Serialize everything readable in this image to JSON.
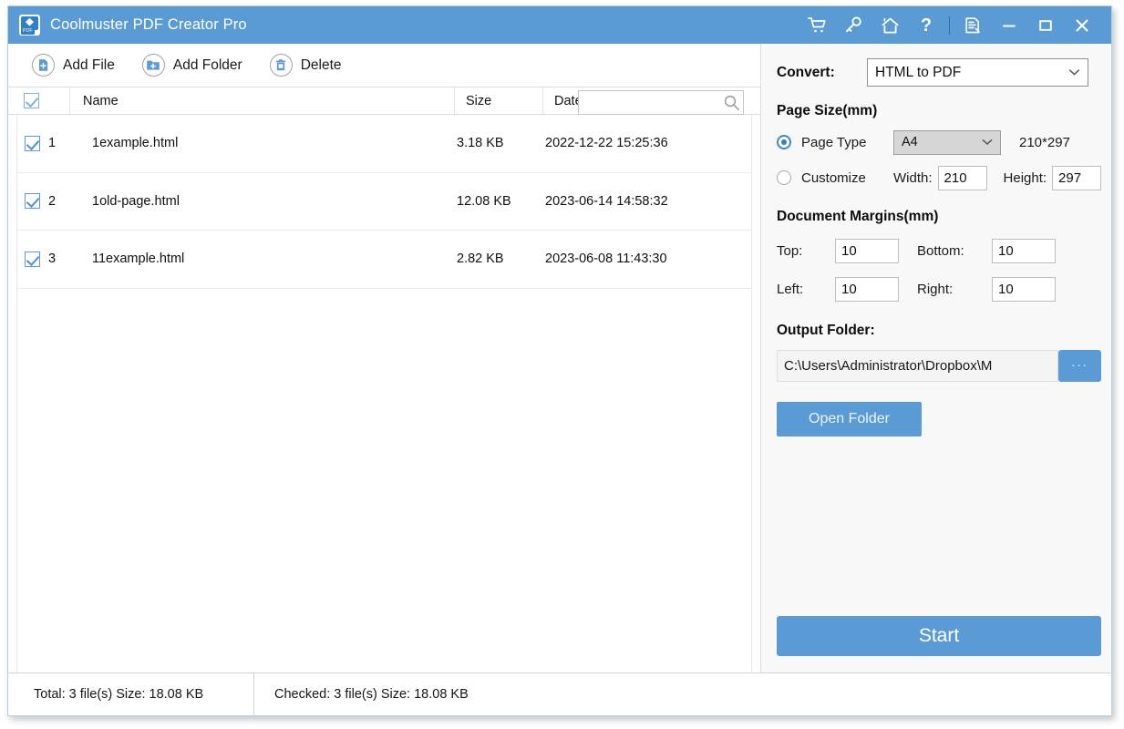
{
  "window": {
    "title": "Coolmuster PDF Creator Pro",
    "accent_color": "#5b9bd5",
    "logo_tag": "PDF"
  },
  "title_actions": [
    {
      "name": "cart-icon",
      "tooltip": "Buy"
    },
    {
      "name": "key-icon",
      "tooltip": "Register"
    },
    {
      "name": "home-icon",
      "tooltip": "Home"
    },
    {
      "name": "help-icon",
      "tooltip": "Help"
    },
    {
      "name": "register-icon",
      "tooltip": "Register"
    },
    {
      "name": "minimize-icon",
      "tooltip": "Minimize"
    },
    {
      "name": "maximize-icon",
      "tooltip": "Maximize"
    },
    {
      "name": "close-icon",
      "tooltip": "Close"
    }
  ],
  "toolbar": {
    "add_file_label": "Add File",
    "add_folder_label": "Add Folder",
    "delete_label": "Delete"
  },
  "search": {
    "value": "",
    "placeholder": ""
  },
  "file_table": {
    "columns": {
      "name": "Name",
      "size": "Size",
      "date": "Date"
    },
    "select_all_checked": true,
    "rows": [
      {
        "index": "1",
        "checked": true,
        "name": "1example.html",
        "size": "3.18 KB",
        "date": "2022-12-22 15:25:36"
      },
      {
        "index": "2",
        "checked": true,
        "name": "1old-page.html",
        "size": "12.08 KB",
        "date": "2023-06-14 14:58:32"
      },
      {
        "index": "3",
        "checked": true,
        "name": "11example.html",
        "size": "2.82 KB",
        "date": "2023-06-08 11:43:30"
      }
    ]
  },
  "settings": {
    "convert_label": "Convert:",
    "convert_value": "HTML to PDF",
    "convert_options": [
      "HTML to PDF"
    ],
    "page_size_title": "Page Size(mm)",
    "page_type_label": "Page Type",
    "page_type_value": "A4",
    "page_type_options": [
      "A4"
    ],
    "page_type_selected": true,
    "page_dimensions": "210*297",
    "customize_label": "Customize",
    "customize_selected": false,
    "width_label": "Width:",
    "width_value": "210",
    "height_label": "Height:",
    "height_value": "297",
    "margins_title": "Document Margins(mm)",
    "top_label": "Top:",
    "top_value": "10",
    "bottom_label": "Bottom:",
    "bottom_value": "10",
    "left_label": "Left:",
    "left_value": "10",
    "right_label": "Right:",
    "right_value": "10",
    "output_title": "Output Folder:",
    "output_path": "C:\\Users\\Administrator\\Dropbox\\M",
    "browse_label": "...",
    "open_folder_label": "Open Folder",
    "start_label": "Start"
  },
  "status_bar": {
    "total": "Total: 3 file(s) Size: 18.08 KB",
    "checked": "Checked: 3 file(s) Size: 18.08 KB"
  }
}
